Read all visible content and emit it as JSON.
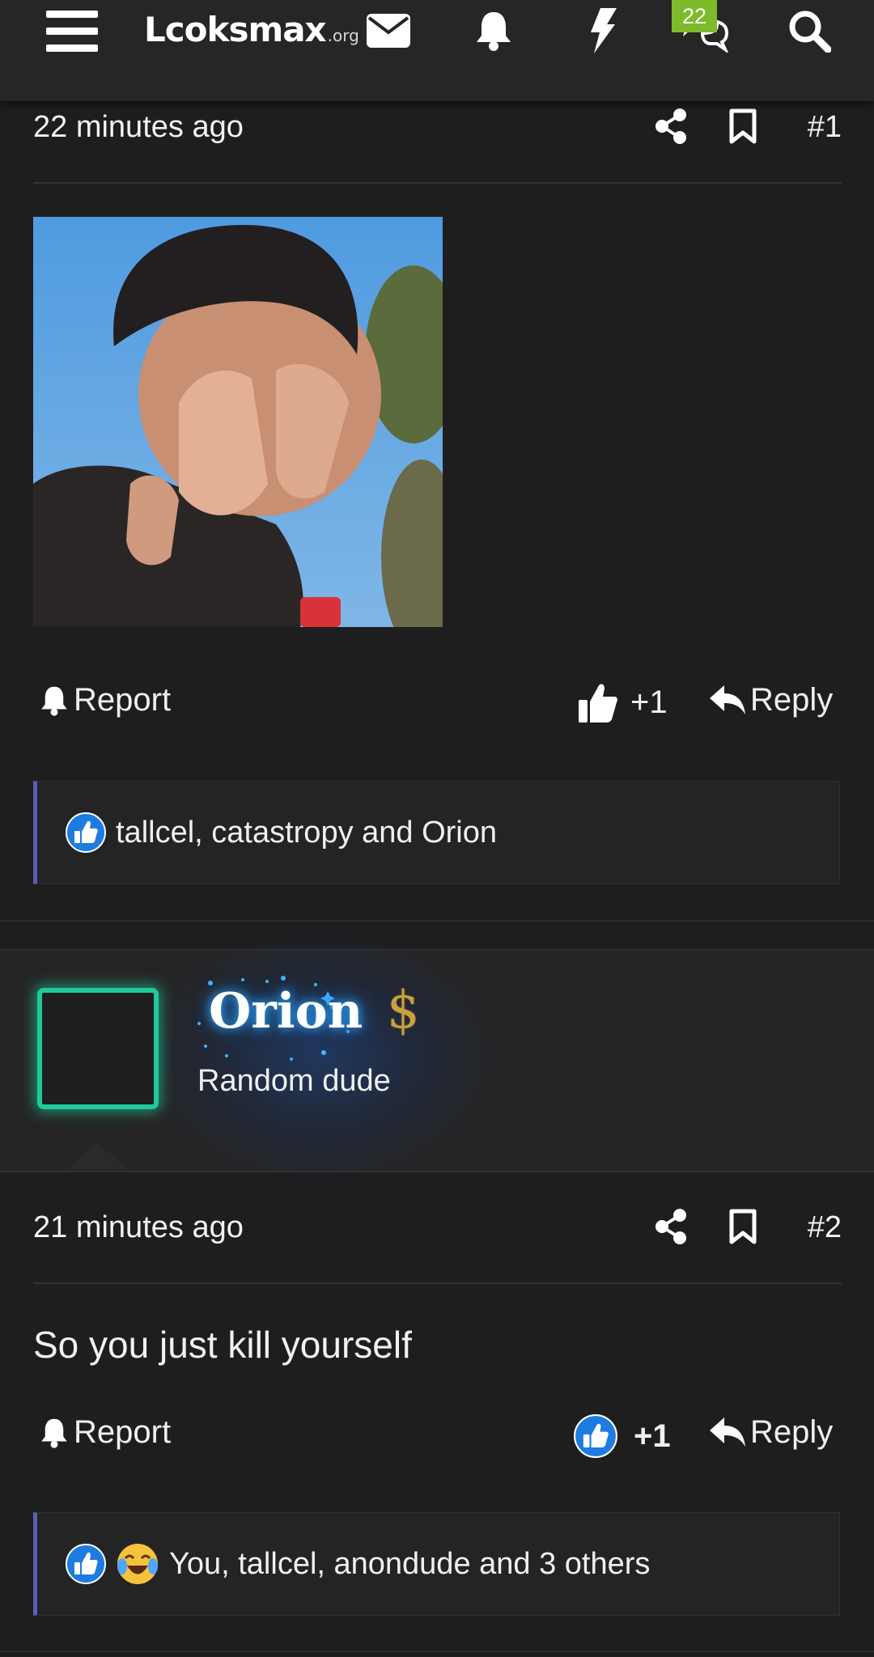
{
  "header": {
    "logo_main": "Lcoksmax",
    "logo_tld": ".org",
    "conversations_badge": "22",
    "icons": [
      "menu-icon",
      "mail-icon",
      "bell-icon",
      "bolt-icon",
      "chat-icon",
      "search-icon"
    ]
  },
  "post1": {
    "time": "22 minutes ago",
    "number": "#1",
    "report_label": "Report",
    "like_count": "+1",
    "reply_label": "Reply",
    "reactions_text": "tallcel, catastropy and Orion"
  },
  "post2": {
    "username": "Orion",
    "user_title": "Random dude",
    "time": "21 minutes ago",
    "number": "#2",
    "body": "So you just kill yourself",
    "report_label": "Report",
    "like_count": "+1",
    "reply_label": "Reply",
    "reactions_text": "You, tallcel, anondude and 3 others"
  },
  "colors": {
    "background": "#1e1e1f",
    "badge": "#7dbb2c",
    "avatar_border": "#1fc99a",
    "reaction_accent": "#5a5fb8",
    "like_blue": "#1e7be0"
  }
}
